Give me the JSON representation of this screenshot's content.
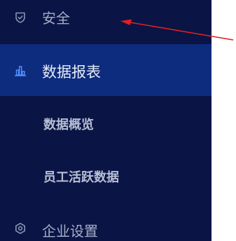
{
  "menu": {
    "security": {
      "label": "安全",
      "icon": "shield-icon"
    },
    "reports": {
      "label": "数据报表",
      "icon": "bar-chart-icon",
      "children": [
        {
          "label": "数据概览"
        },
        {
          "label": "员工活跃数据"
        }
      ]
    },
    "enterprise": {
      "label": "企业设置",
      "icon": "hexagon-settings-icon"
    }
  },
  "colors": {
    "sidebar_bg": "#0a1445",
    "active_bg": "#0d2c7d",
    "annotation_arrow": "#e02020"
  }
}
